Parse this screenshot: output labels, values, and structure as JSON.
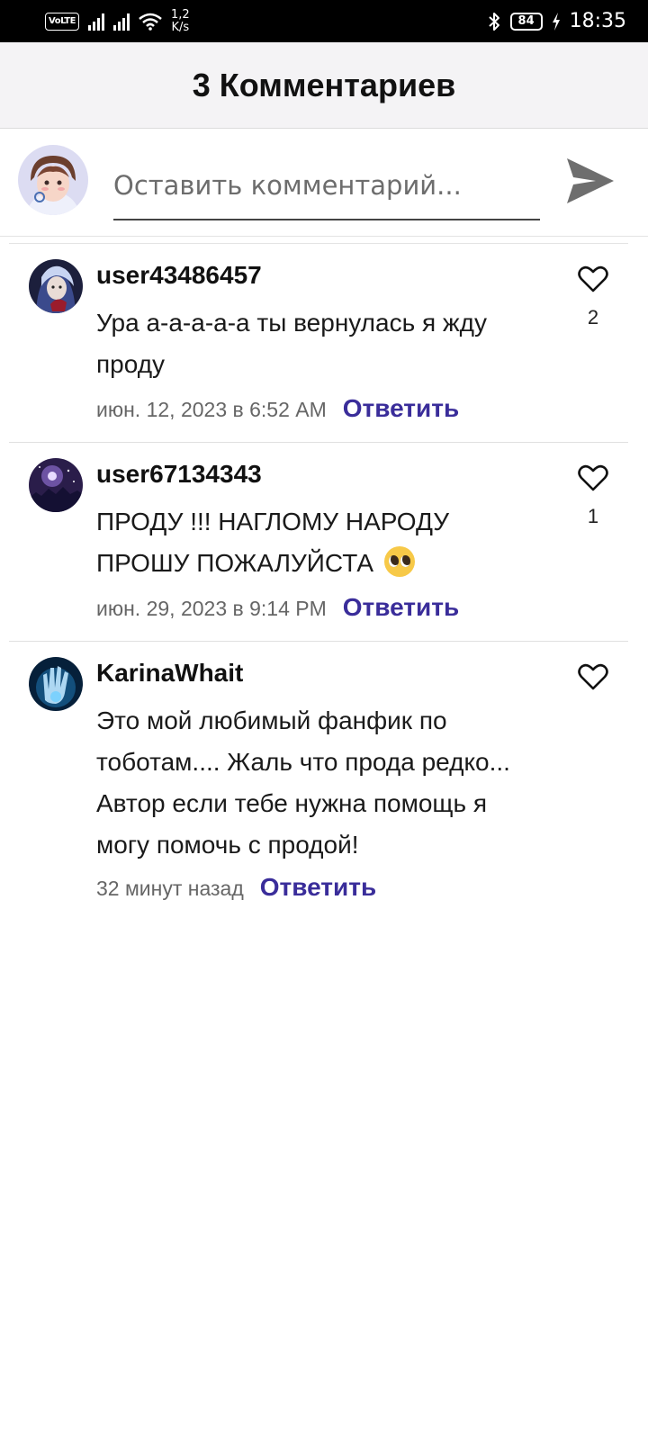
{
  "status_bar": {
    "volte": "VoLTE",
    "speed_value": "1,2",
    "speed_unit": "K/s",
    "battery": "84",
    "time": "18:35"
  },
  "header": {
    "title": "3 Комментариев"
  },
  "compose": {
    "placeholder": "Оставить комментарий...",
    "value": ""
  },
  "comments": [
    {
      "username": "user43486457",
      "text": "Ура а-а-а-а-а  ты вернулась я жду проду",
      "date": "июн. 12, 2023 в 6:52 AM",
      "reply_label": "Ответить",
      "likes": "2"
    },
    {
      "username": "user67134343",
      "text": "ПРОДУ !!! НАГЛОМУ НАРОДУ ПРОШУ ПОЖАЛУЙСТА",
      "date": "июн. 29, 2023 в 9:14 PM",
      "reply_label": "Ответить",
      "likes": "1"
    },
    {
      "username": "KarinaWhait",
      "text": "Это мой любимый фанфик по тоботам.... Жаль что прода редко... Автор если тебе нужна помощь я могу помочь с продой!",
      "date": "32 минут назад",
      "reply_label": "Ответить",
      "likes": ""
    }
  ],
  "colors": {
    "reply_accent": "#3a2d9a",
    "header_bg": "#f4f3f5"
  }
}
